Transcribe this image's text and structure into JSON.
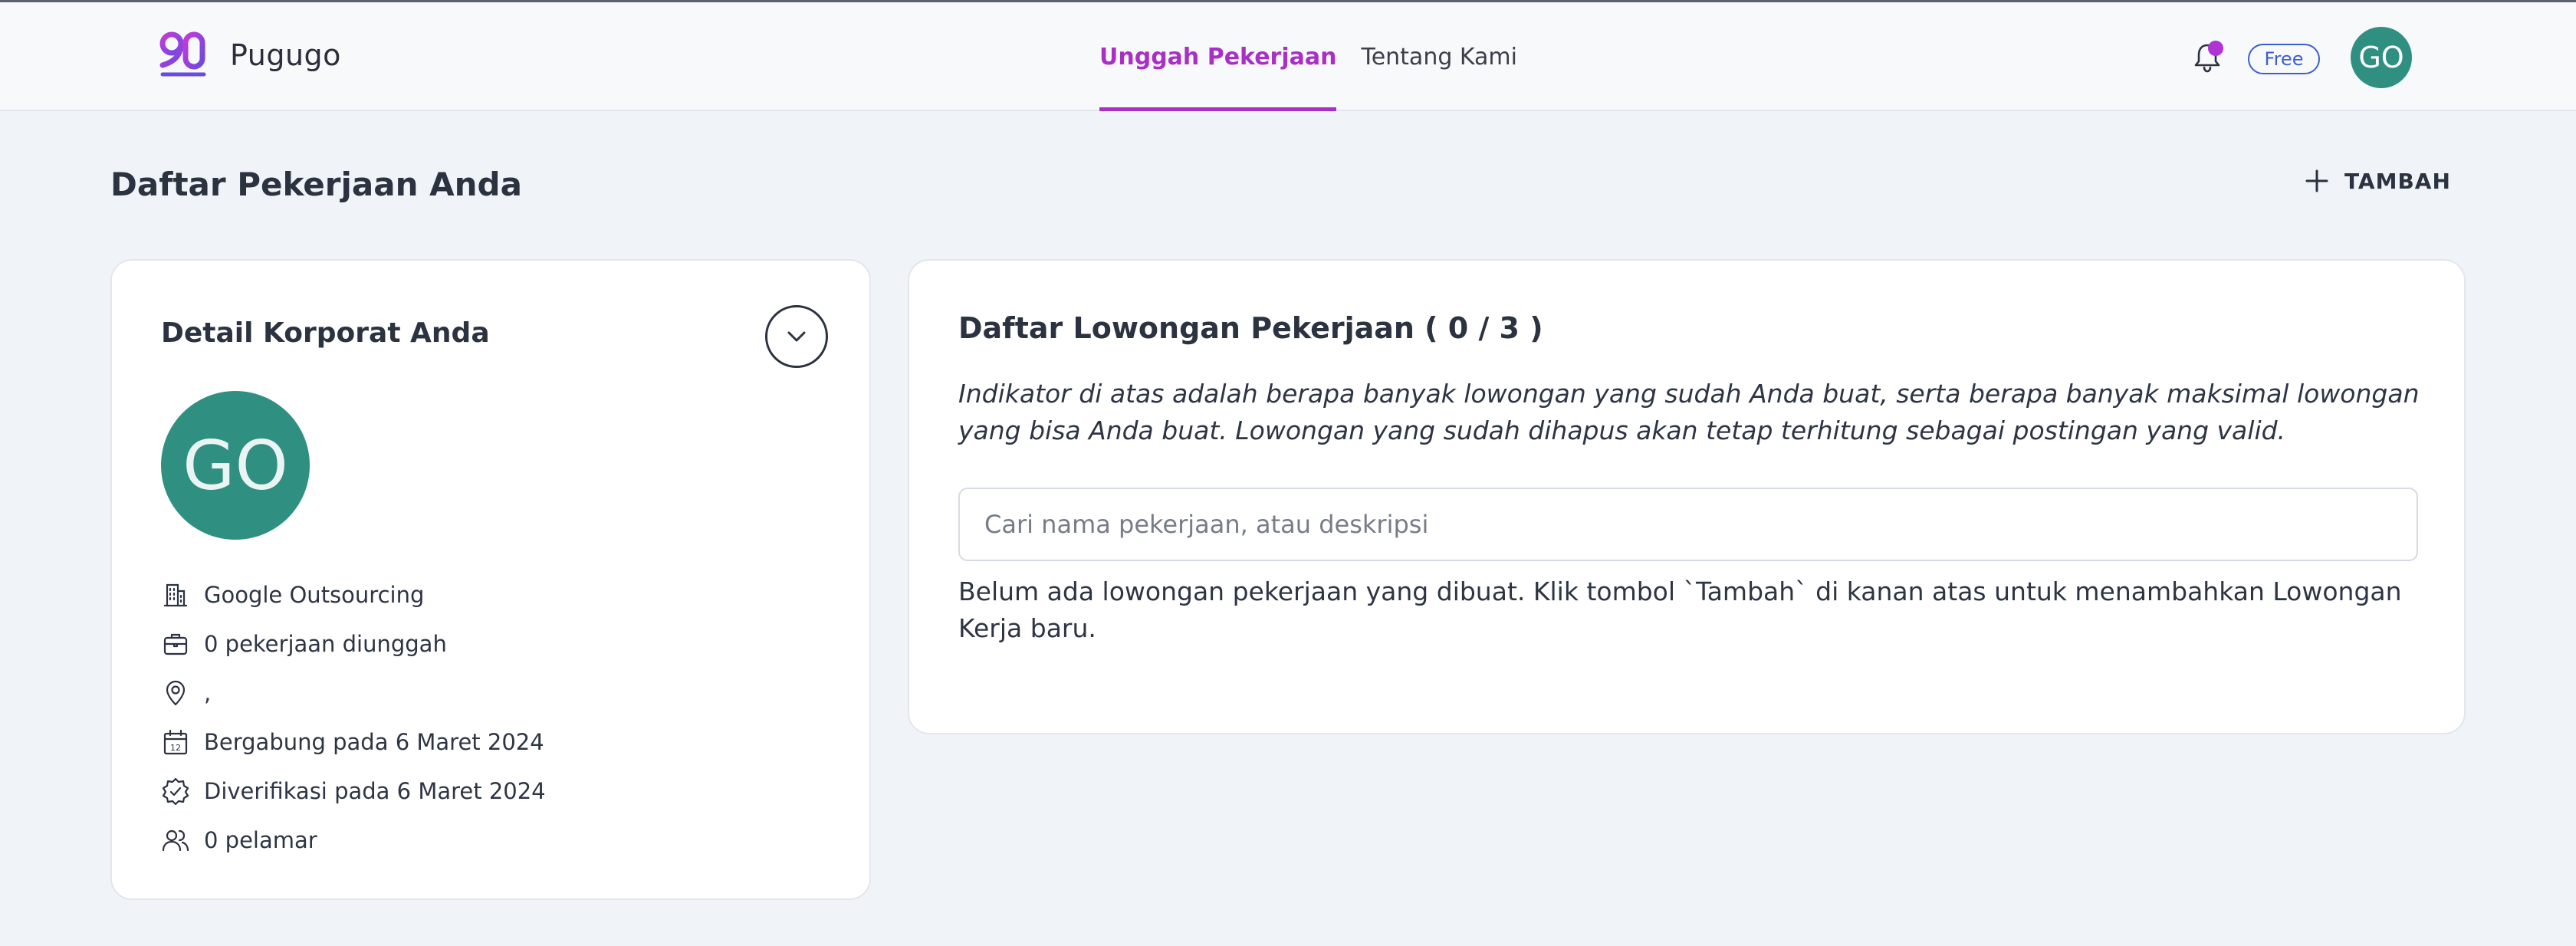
{
  "app": {
    "name": "Pugugo"
  },
  "nav": {
    "items": [
      {
        "label": "Unggah Pekerjaan",
        "active": true
      },
      {
        "label": "Tentang Kami",
        "active": false
      }
    ]
  },
  "header": {
    "plan_badge": "Free",
    "avatar_initials": "GO",
    "notification_dot_color": "#b033d6"
  },
  "page": {
    "title": "Daftar Pekerjaan Anda",
    "add_label": "TAMBAH"
  },
  "corporate": {
    "title": "Detail Korporat Anda",
    "avatar_initials": "GO",
    "company": "Google Outsourcing",
    "jobs_uploaded": "0 pekerjaan diunggah",
    "location": ",",
    "joined": "Bergabung pada 6 Maret 2024",
    "verified": "Diverifikasi pada 6 Maret 2024",
    "applicants": "0 pelamar",
    "icons": [
      "building-icon",
      "briefcase-icon",
      "location-pin-icon",
      "calendar-icon",
      "verified-badge-icon",
      "users-icon"
    ]
  },
  "jobs": {
    "title": "Daftar Lowongan Pekerjaan ( 0 / 3 )",
    "description": "Indikator di atas adalah berapa banyak lowongan yang sudah Anda buat, serta berapa banyak maksimal lowongan yang bisa Anda buat. Lowongan yang sudah dihapus akan tetap terhitung sebagai postingan yang valid.",
    "search_placeholder": "Cari nama pekerjaan, atau deskripsi",
    "search_value": "",
    "empty_message": "Belum ada lowongan pekerjaan yang dibuat. Klik tombol `Tambah` di kanan atas untuk menambahkan Lowongan Kerja baru."
  },
  "colors": {
    "accent": "#a930c4",
    "avatar_bg": "#2f9082",
    "badge": "#3b5fd0",
    "background": "#f0f3f8"
  }
}
